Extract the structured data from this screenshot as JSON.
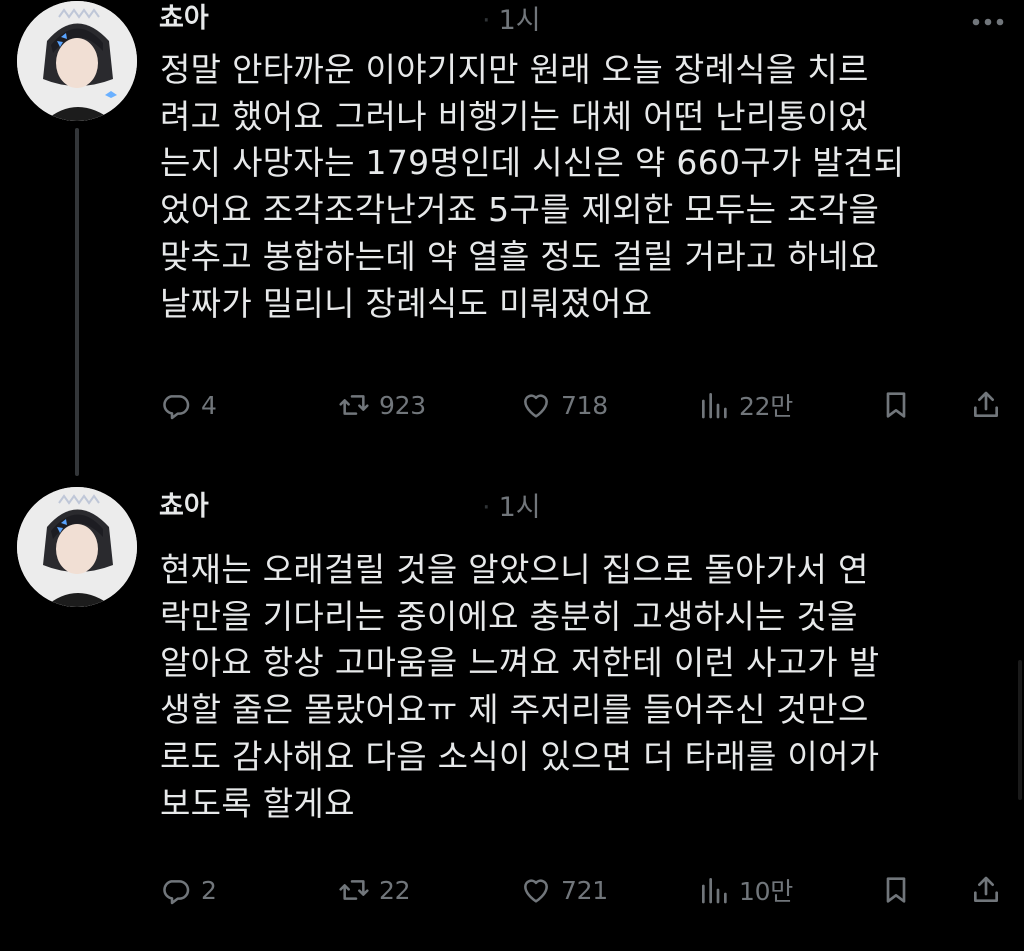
{
  "tweets": [
    {
      "name": "쵸아",
      "time": "1시",
      "text_lines": [
        "정말 안타까운 이야기지만 원래 오늘 장례식을 치르",
        "려고 했어요 그러나 비행기는 대체 어떤 난리통이었",
        "는지 사망자는 179명인데 시신은 약 660구가 발견되",
        "었어요 조각조각난거죠 5구를 제외한 모두는 조각을",
        "맞추고 봉합하는데 약 열흘 정도 걸릴 거라고 하네요",
        "날짜가 밀리니 장례식도 미뤄졌어요"
      ],
      "replies": "4",
      "retweets": "923",
      "likes": "718",
      "views": "22만"
    },
    {
      "name": "쵸아",
      "time": "1시",
      "text_lines": [
        "현재는 오래걸릴 것을 알았으니 집으로 돌아가서 연",
        "락만을 기다리는 중이에요 충분히 고생하시는 것을",
        "알아요 항상 고마움을 느껴요 저한테 이런 사고가 발",
        "생할 줄은 몰랐어요ㅠ 제 주저리를 들어주신 것만으",
        "로도 감사해요 다음 소식이 있으면 더 타래를 이어가",
        "보도록 할게요"
      ],
      "replies": "2",
      "retweets": "22",
      "likes": "721",
      "views": "10만"
    }
  ],
  "icons": {
    "reply": "reply-icon",
    "retweet": "retweet-icon",
    "like": "heart-icon",
    "views": "views-icon",
    "bookmark": "bookmark-icon",
    "share": "share-icon",
    "more": "more-icon"
  },
  "colors": {
    "background": "#000000",
    "text": "#e7e9ea",
    "muted": "#71767b",
    "thread_line": "#333639"
  }
}
